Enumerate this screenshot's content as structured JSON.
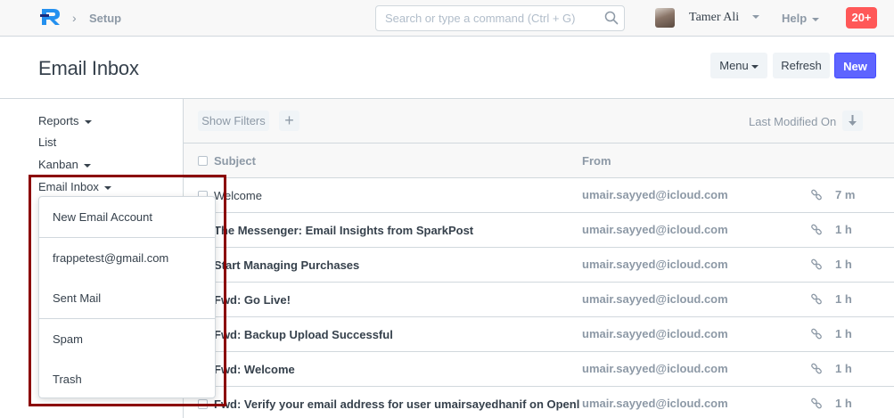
{
  "navbar": {
    "breadcrumb": "Setup",
    "search_placeholder": "Search or type a command (Ctrl + G)",
    "user_name": "Tamer Ali",
    "help_label": "Help",
    "notification_count": "20+"
  },
  "page": {
    "title": "Email Inbox",
    "menu_label": "Menu",
    "refresh_label": "Refresh",
    "new_label": "New"
  },
  "sidebar": {
    "items": [
      {
        "label": "Reports"
      },
      {
        "label": "List"
      },
      {
        "label": "Kanban"
      },
      {
        "label": "Email Inbox"
      }
    ]
  },
  "dropdown": {
    "items": [
      {
        "label": "New Email Account"
      },
      {
        "label": "frappetest@gmail.com"
      },
      {
        "label": "Sent Mail"
      },
      {
        "label": "Spam"
      },
      {
        "label": "Trash"
      }
    ]
  },
  "list": {
    "show_filters_label": "Show Filters",
    "add_label": "+",
    "sort_label": "Last Modified On",
    "columns": {
      "subject": "Subject",
      "from": "From"
    },
    "rows": [
      {
        "subject": "Welcome",
        "from": "umair.sayyed@icloud.com",
        "time": "7 m",
        "unread": false
      },
      {
        "subject": "The Messenger: Email Insights from SparkPost",
        "from": "umair.sayyed@icloud.com",
        "time": "1 h",
        "unread": true
      },
      {
        "subject": "Start Managing Purchases",
        "from": "umair.sayyed@icloud.com",
        "time": "1 h",
        "unread": true
      },
      {
        "subject": "Fwd: Go Live!",
        "from": "umair.sayyed@icloud.com",
        "time": "1 h",
        "unread": true
      },
      {
        "subject": "Fwd: Backup Upload Successful",
        "from": "umair.sayyed@icloud.com",
        "time": "1 h",
        "unread": true
      },
      {
        "subject": "Fwd: Welcome",
        "from": "umair.sayyed@icloud.com",
        "time": "1 h",
        "unread": true
      },
      {
        "subject": "Fwd: Verify your email address for user umairsayedhanif on Openl",
        "from": "umair.sayyed@icloud.com",
        "time": "1 h",
        "unread": true
      }
    ]
  },
  "colors": {
    "primary": "#5e64ff",
    "notification": "#ff5858",
    "highlight": "#8b0000",
    "muted_text": "#8d99a6",
    "text": "#36414c"
  }
}
